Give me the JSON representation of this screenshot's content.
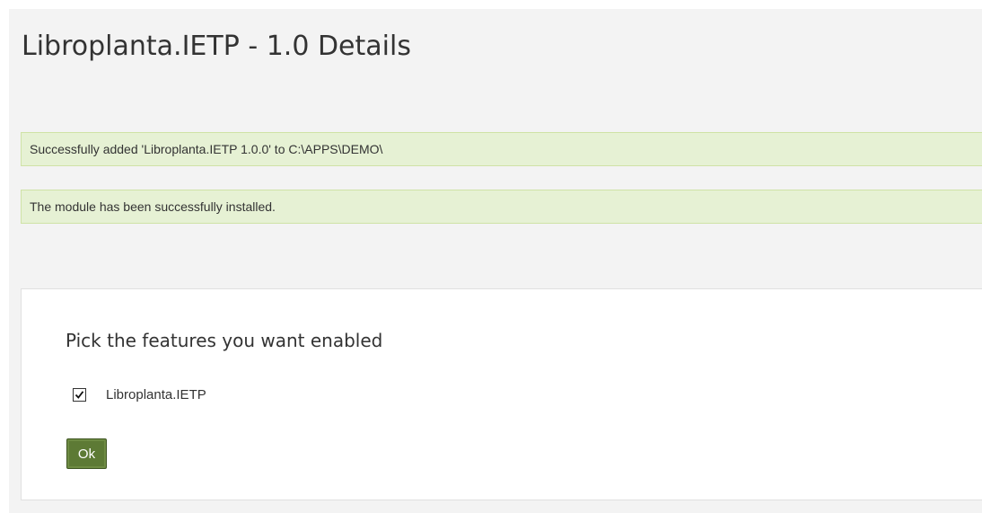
{
  "page": {
    "title": "Libroplanta.IETP - 1.0 Details"
  },
  "messages": [
    {
      "text": "Successfully added 'Libroplanta.IETP 1.0.0' to C:\\APPS\\DEMO\\"
    },
    {
      "text": "The module has been successfully installed."
    }
  ],
  "features": {
    "heading": "Pick the features you want enabled",
    "items": [
      {
        "label": "Libroplanta.IETP",
        "checked": true
      }
    ],
    "ok_label": "Ok"
  },
  "colors": {
    "message_background": "#e6f1d4",
    "message_border": "#cfe2a6",
    "button_background": "#5d7a35",
    "page_background": "#f3f3f3"
  }
}
